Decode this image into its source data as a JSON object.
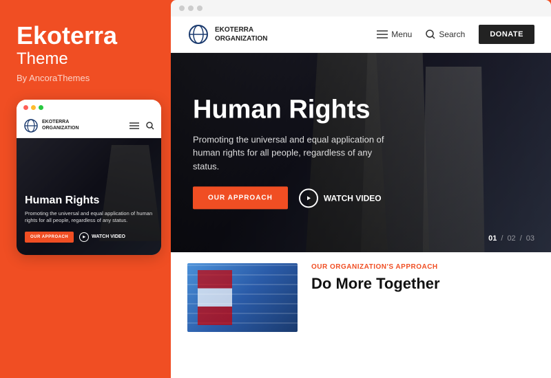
{
  "left_panel": {
    "brand": {
      "title": "Ekoterra",
      "subtitle": "Theme",
      "by": "By AncoraThemes"
    },
    "mobile_mockup": {
      "dots": [
        "red",
        "yellow",
        "green"
      ],
      "nav": {
        "logo_name": "EKOTERRA",
        "logo_sub": "ORGANIZATION"
      },
      "hero": {
        "title": "Human Rights",
        "description": "Promoting the universal and equal application of human rights for all people, regardless of any status.",
        "btn_approach": "OUR APPROACH",
        "btn_watch": "WATCH VIDEO"
      }
    }
  },
  "right_panel": {
    "browser_dots": [
      "dot1",
      "dot2",
      "dot3"
    ],
    "desktop_nav": {
      "logo_name": "EKOTERRA",
      "logo_sub": "ORGANIZATION",
      "menu_label": "Menu",
      "search_label": "Search",
      "donate_label": "DONATE"
    },
    "desktop_hero": {
      "title": "Human Rights",
      "description": "Promoting the universal and equal application of human rights for all people, regardless of any status.",
      "btn_approach": "OUR APPROACH",
      "btn_watch": "WATCH VIDEO",
      "slide_current": "01",
      "slide_sep": "/",
      "slide_2": "02",
      "slide_3": "03"
    },
    "desktop_bottom": {
      "label": "OUR ORGANIZATION'S APPROACH",
      "heading": "Do More Together"
    }
  }
}
